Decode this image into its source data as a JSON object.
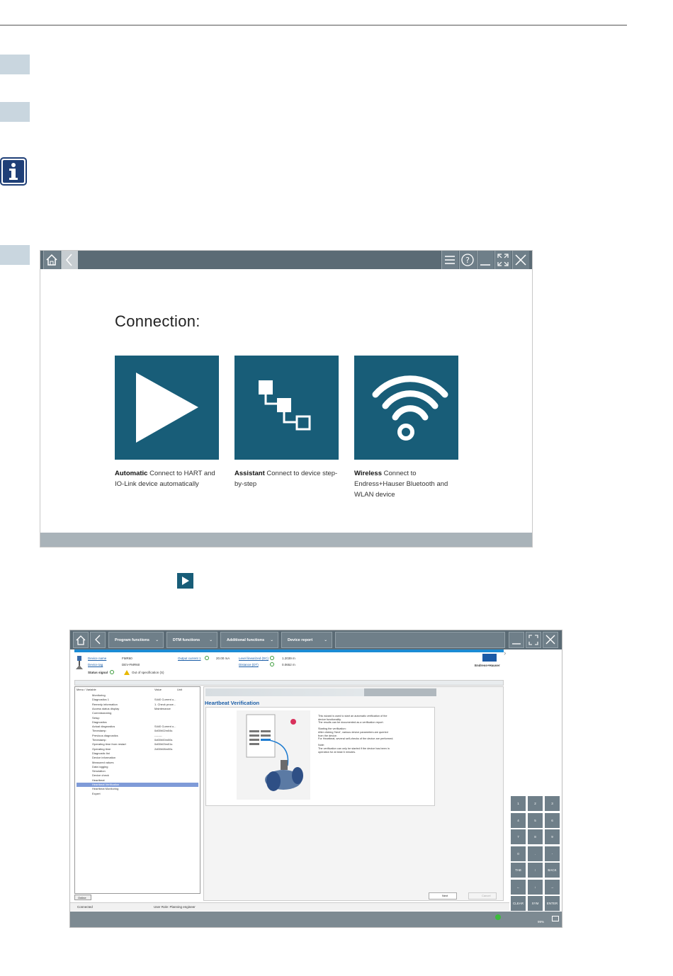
{
  "screen1": {
    "title": "Connection:",
    "tiles": [
      {
        "bold": "Automatic",
        "text": "Connect to HART and IO-Link device automatically",
        "icon": "play-icon"
      },
      {
        "bold": "Assistant",
        "text": "Connect to device step-by-step",
        "icon": "network-steps-icon"
      },
      {
        "bold": "Wireless",
        "text": "Connect to Endress+Hauser Bluetooth and WLAN device",
        "icon": "wifi-icon"
      }
    ]
  },
  "screen2": {
    "menus": [
      "Program functions",
      "DTM functions",
      "Additional functions",
      "Device report"
    ],
    "header": {
      "device_name_label": "Device name",
      "device_name_value": "FMR60",
      "device_tag_label": "Device tag",
      "device_tag_value": "DEV-FMR60",
      "status_label": "Status signal",
      "status_value": "Out of specification (S)",
      "output_label": "Output current 1",
      "output_value": "20.00 mA",
      "level_label": "Level linearized (DC)",
      "level_value": "1.2039 m",
      "distance_label": "Distance (DT)",
      "distance_value": "0.0652 m",
      "brand": "Endress+Hauser"
    },
    "tree_headers": {
      "name": "Menu / Variable",
      "value": "Value",
      "unit": "Unit"
    },
    "tree": [
      {
        "label": "Monitoring",
        "value": ""
      },
      {
        "label": "Diagnostics 1",
        "value": "S440 Current o..."
      },
      {
        "label": "Remedy information",
        "value": "1. Check proce..."
      },
      {
        "label": "Access status display",
        "value": "Maintenance"
      },
      {
        "label": "Commissioning",
        "value": ""
      },
      {
        "label": "Setup",
        "value": ""
      },
      {
        "label": "Diagnostics",
        "value": ""
      },
      {
        "label": "Actual diagnostics",
        "value": "S440 Current o..."
      },
      {
        "label": "Timestamp",
        "value": "0d00h02m04s"
      },
      {
        "label": "Previous diagnostics",
        "value": "--------"
      },
      {
        "label": "Timestamp",
        "value": "0d00h00m00s"
      },
      {
        "label": "Operating time from restart",
        "value": "0d00h03m01s"
      },
      {
        "label": "Operating time",
        "value": "2d00h08m00s"
      },
      {
        "label": "Diagnostic list",
        "value": ""
      },
      {
        "label": "Device information",
        "value": ""
      },
      {
        "label": "Measured values",
        "value": ""
      },
      {
        "label": "Data logging",
        "value": ""
      },
      {
        "label": "Simulation",
        "value": ""
      },
      {
        "label": "Device check",
        "value": ""
      },
      {
        "label": "Heartbeat",
        "value": ""
      },
      {
        "label": "Heartbeat Verification",
        "value": ""
      },
      {
        "label": "Heartbeat Monitoring",
        "value": ""
      },
      {
        "label": "Expert",
        "value": ""
      }
    ],
    "tree_tab": "Online",
    "main_title": "Heartbeat Verification",
    "description": [
      "This wizard is used to start an automatic verification of the",
      "device functionality.",
      "The results can be documented as a verification report.",
      "",
      "Starting the verification:",
      "After clicking 'Next', various device parameters are queried",
      "from the device.",
      "For Heartbeat, several self-checks of the device are performed.",
      "",
      "Note:",
      "The verification can only be started if the device has been in",
      "operation for at least 6 minutes."
    ],
    "next_label": "Next",
    "cancel_label": "Cancel",
    "numpad": [
      "1",
      "2",
      "3",
      "4",
      "5",
      "6",
      "7",
      "8",
      "9",
      "0",
      ".",
      "-",
      "TAB",
      "↑",
      "BACK",
      "←",
      "↓",
      "→",
      "CLEAR",
      "SYM",
      "ENTER"
    ],
    "status": {
      "connected": "Connected",
      "user_role": "User Role: Planning engineer"
    },
    "tray": {
      "battery": "99%"
    }
  }
}
